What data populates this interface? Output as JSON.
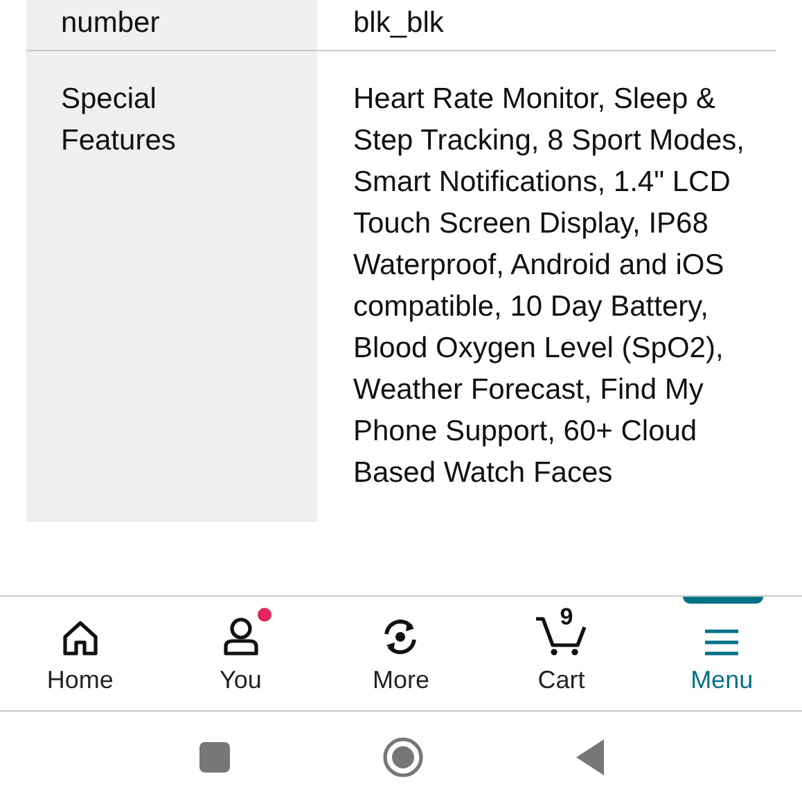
{
  "spec_rows": [
    {
      "label": "number",
      "value": "blk_blk"
    },
    {
      "label": "Special Features",
      "value": "Heart Rate Monitor, Sleep & Step Tracking, 8 Sport Modes, Smart Notifications, 1.4\" LCD Touch Screen Display, IP68 Waterproof, Android and iOS compatible, 10 Day Battery, Blood Oxygen Level (SpO2), Weather Forecast, Find My Phone Support, 60+ Cloud Based Watch Faces"
    }
  ],
  "nav": [
    {
      "kind": "home",
      "label": "Home",
      "selected": false
    },
    {
      "kind": "you",
      "label": "You",
      "selected": false,
      "notification": true
    },
    {
      "kind": "more",
      "label": "More",
      "selected": false
    },
    {
      "kind": "cart",
      "label": "Cart",
      "selected": false,
      "count": "9"
    },
    {
      "kind": "menu",
      "label": "Menu",
      "selected": true
    }
  ]
}
